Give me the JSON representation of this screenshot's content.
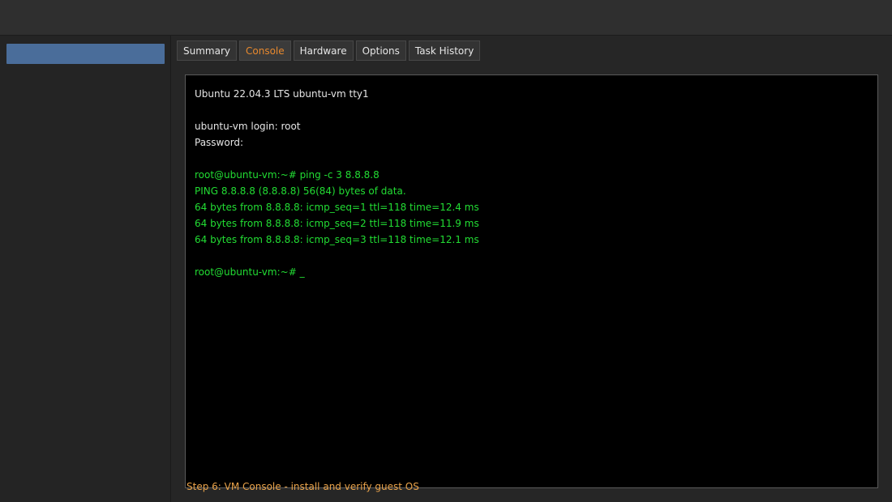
{
  "colors": {
    "selection": "#4a6d9a",
    "active_tab_text": "#e8892e",
    "terminal_text": "#e6e6e6",
    "terminal_green": "#22dd33",
    "step_text": "#e8a24a"
  },
  "sidebar": {
    "items": [
      {
        "label": "",
        "selected": true
      }
    ]
  },
  "tabs": [
    {
      "label": "Summary",
      "active": false
    },
    {
      "label": "Console",
      "active": true
    },
    {
      "label": "Hardware",
      "active": false
    },
    {
      "label": "Options",
      "active": false
    },
    {
      "label": "Task History",
      "active": false
    }
  ],
  "console": {
    "lines": [
      {
        "text": "Ubuntu 22.04.3 LTS ubuntu-vm tty1",
        "style": "plain"
      },
      {
        "text": "",
        "style": "plain"
      },
      {
        "text": "ubuntu-vm login: root",
        "style": "plain"
      },
      {
        "text": "Password:",
        "style": "plain"
      },
      {
        "text": "",
        "style": "plain"
      },
      {
        "text": "root@ubuntu-vm:~# ping -c 3 8.8.8.8",
        "style": "green"
      },
      {
        "text": "PING 8.8.8.8 (8.8.8.8) 56(84) bytes of data.",
        "style": "green"
      },
      {
        "text": "64 bytes from 8.8.8.8: icmp_seq=1 ttl=118 time=12.4 ms",
        "style": "green"
      },
      {
        "text": "64 bytes from 8.8.8.8: icmp_seq=2 ttl=118 time=11.9 ms",
        "style": "green"
      },
      {
        "text": "64 bytes from 8.8.8.8: icmp_seq=3 ttl=118 time=12.1 ms",
        "style": "green"
      },
      {
        "text": "",
        "style": "plain"
      },
      {
        "text": "root@ubuntu-vm:~# _",
        "style": "green"
      }
    ]
  },
  "step_label": "Step 6: VM Console - install and verify guest OS"
}
